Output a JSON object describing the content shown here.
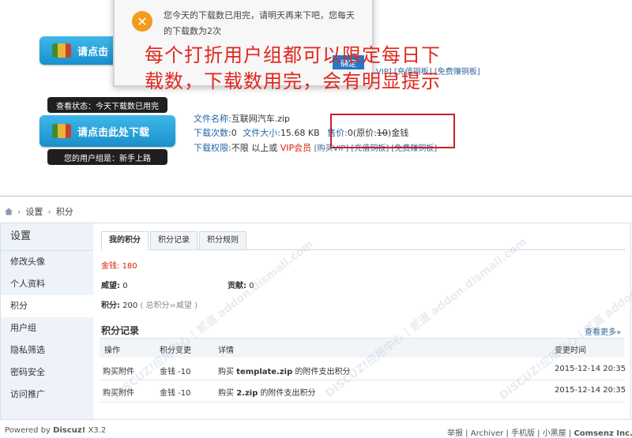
{
  "dialog": {
    "message": "您今天的下载数已用完，请明天再来下吧，您每天的下载数为2次",
    "ok_label": "确定"
  },
  "download_button_label": "请点击此处下载",
  "download_button_label_partial": "请点击",
  "annotation": {
    "line1": "每个打折用户组都可以限定每日下",
    "line2": "载数，下载数用完，会有明显提示"
  },
  "top_links_partial": "VIP] [充值铜板] [免费赚铜板]",
  "status_tip": "查看状态：今天下载数已用完",
  "group_tip": "您的用户组是：新手上路",
  "file": {
    "name_label": "文件名称:",
    "name": "互联网汽车.zip",
    "downloads_label": "下载次数:",
    "downloads": "0",
    "size_label": "文件大小:",
    "size": "15.68 KB",
    "price_label": "售价:",
    "price_prefix": "0(原价:",
    "price_original": "10",
    "price_suffix": ")金钱",
    "perm_label": "下载权限:",
    "perm_text": "不限 以上或",
    "perm_vip": "VIP会员",
    "perm_links": "[购买VIP] [充值铜板] [免费赚铜板]"
  },
  "breadcrumb": [
    "设置",
    "积分"
  ],
  "sidebar": {
    "title": "设置",
    "items": [
      "修改头像",
      "个人资料",
      "积分",
      "用户组",
      "隐私筛选",
      "密码安全",
      "访问推广"
    ],
    "active_index": 2
  },
  "tabs": [
    "我的积分",
    "积分记录",
    "积分规则"
  ],
  "active_tab": 0,
  "credits": {
    "money_label": "金钱:",
    "money": "180",
    "prestige_label": "威望:",
    "prestige": "0",
    "contribution_label": "贡献:",
    "contribution": "0",
    "points_label": "积分:",
    "points": "200",
    "points_note": "( 总积分=威望 )"
  },
  "records": {
    "title": "积分记录",
    "more": "查看更多»",
    "headers": [
      "操作",
      "积分变更",
      "详情",
      "变更时间"
    ],
    "rows": [
      {
        "action": "购买附件",
        "change": "金钱 -10",
        "detail_pre": "购买",
        "detail_file": "template.zip",
        "detail_post": "的附件支出积分",
        "time": "2015-12-14 20:35"
      },
      {
        "action": "购买附件",
        "change": "金钱 -10",
        "detail_pre": "购买",
        "detail_file": "2.zip",
        "detail_post": "的附件支出积分",
        "time": "2015-12-14 20:35"
      }
    ]
  },
  "footer": {
    "powered_label": "Powered by",
    "powered_brand": "Discuz!",
    "powered_version": "X3.2",
    "links": [
      "举报",
      "Archiver",
      "手机版",
      "小黑屋"
    ],
    "company": "Comsenz Inc."
  },
  "watermark": "DISCUZ!应用中心 | 贰道 addon.dismall.com"
}
